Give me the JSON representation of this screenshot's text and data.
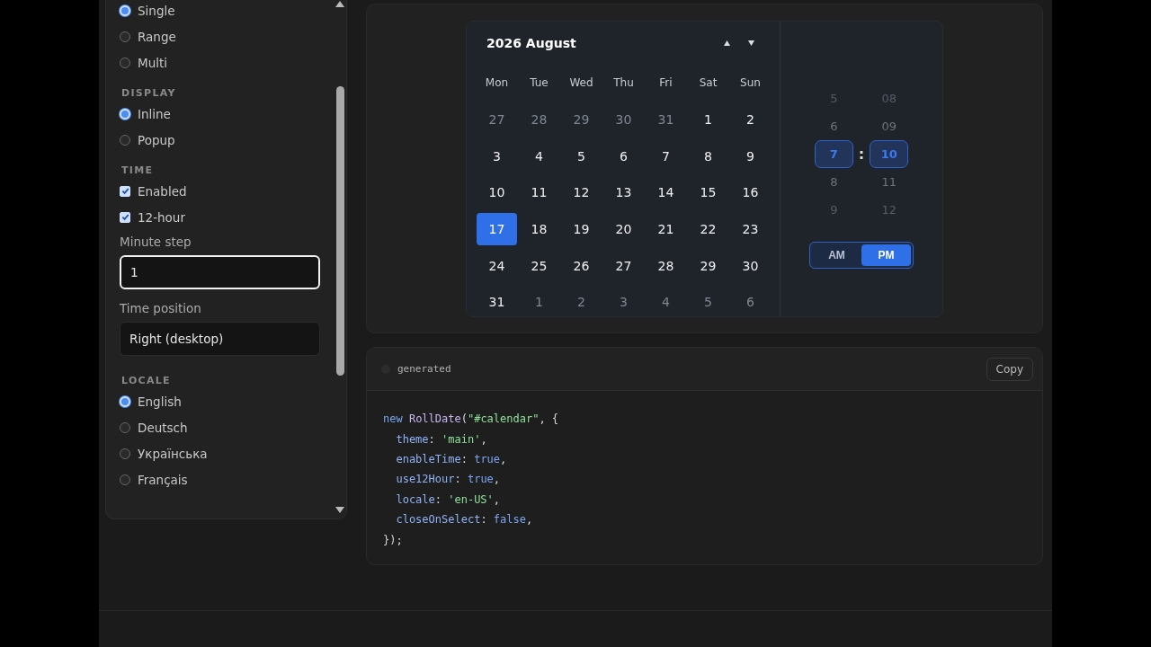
{
  "sidebar": {
    "items": [
      {
        "kind": "radio",
        "label": "Single",
        "selected": true
      },
      {
        "kind": "radio",
        "label": "Range",
        "selected": false
      },
      {
        "kind": "radio",
        "label": "Multi",
        "selected": false
      },
      {
        "kind": "heading",
        "label": "DISPLAY"
      },
      {
        "kind": "radio",
        "label": "Inline",
        "selected": true
      },
      {
        "kind": "radio",
        "label": "Popup",
        "selected": false
      },
      {
        "kind": "heading",
        "label": "TIME"
      },
      {
        "kind": "checkbox",
        "label": "Enabled",
        "checked": true
      },
      {
        "kind": "checkbox",
        "label": "12-hour",
        "checked": true
      },
      {
        "kind": "label",
        "label": "Minute step"
      },
      {
        "kind": "input",
        "value": "1",
        "focused": true
      },
      {
        "kind": "label",
        "label": "Time position"
      },
      {
        "kind": "select",
        "value": "Right (desktop)"
      },
      {
        "kind": "heading",
        "label": "LOCALE"
      },
      {
        "kind": "radio",
        "label": "English",
        "selected": true
      },
      {
        "kind": "radio",
        "label": "Deutsch",
        "selected": false
      },
      {
        "kind": "radio",
        "label": "Українська",
        "selected": false
      },
      {
        "kind": "radio",
        "label": "Français",
        "selected": false
      }
    ]
  },
  "calendar": {
    "title": "2026 August",
    "weekdays": [
      "Mon",
      "Tue",
      "Wed",
      "Thu",
      "Fri",
      "Sat",
      "Sun"
    ],
    "days": [
      {
        "label": "27",
        "muted": true,
        "selected": false
      },
      {
        "label": "28",
        "muted": true,
        "selected": false
      },
      {
        "label": "29",
        "muted": true,
        "selected": false
      },
      {
        "label": "30",
        "muted": true,
        "selected": false
      },
      {
        "label": "31",
        "muted": true,
        "selected": false
      },
      {
        "label": "1",
        "muted": false,
        "selected": false
      },
      {
        "label": "2",
        "muted": false,
        "selected": false
      },
      {
        "label": "3",
        "muted": false,
        "selected": false
      },
      {
        "label": "4",
        "muted": false,
        "selected": false
      },
      {
        "label": "5",
        "muted": false,
        "selected": false
      },
      {
        "label": "6",
        "muted": false,
        "selected": false
      },
      {
        "label": "7",
        "muted": false,
        "selected": false
      },
      {
        "label": "8",
        "muted": false,
        "selected": false
      },
      {
        "label": "9",
        "muted": false,
        "selected": false
      },
      {
        "label": "10",
        "muted": false,
        "selected": false
      },
      {
        "label": "11",
        "muted": false,
        "selected": false
      },
      {
        "label": "12",
        "muted": false,
        "selected": false
      },
      {
        "label": "13",
        "muted": false,
        "selected": false
      },
      {
        "label": "14",
        "muted": false,
        "selected": false
      },
      {
        "label": "15",
        "muted": false,
        "selected": false
      },
      {
        "label": "16",
        "muted": false,
        "selected": false
      },
      {
        "label": "17",
        "muted": false,
        "selected": true
      },
      {
        "label": "18",
        "muted": false,
        "selected": false
      },
      {
        "label": "19",
        "muted": false,
        "selected": false
      },
      {
        "label": "20",
        "muted": false,
        "selected": false
      },
      {
        "label": "21",
        "muted": false,
        "selected": false
      },
      {
        "label": "22",
        "muted": false,
        "selected": false
      },
      {
        "label": "23",
        "muted": false,
        "selected": false
      },
      {
        "label": "24",
        "muted": false,
        "selected": false
      },
      {
        "label": "25",
        "muted": false,
        "selected": false
      },
      {
        "label": "26",
        "muted": false,
        "selected": false
      },
      {
        "label": "27",
        "muted": false,
        "selected": false
      },
      {
        "label": "28",
        "muted": false,
        "selected": false
      },
      {
        "label": "29",
        "muted": false,
        "selected": false
      },
      {
        "label": "30",
        "muted": false,
        "selected": false
      },
      {
        "label": "31",
        "muted": false,
        "selected": false
      },
      {
        "label": "1",
        "muted": true,
        "selected": false
      },
      {
        "label": "2",
        "muted": true,
        "selected": false
      },
      {
        "label": "3",
        "muted": true,
        "selected": false
      },
      {
        "label": "4",
        "muted": true,
        "selected": false
      },
      {
        "label": "5",
        "muted": true,
        "selected": false
      },
      {
        "label": "6",
        "muted": true,
        "selected": false
      }
    ]
  },
  "time": {
    "hours": [
      {
        "label": "5",
        "selected": false
      },
      {
        "label": "6",
        "selected": false
      },
      {
        "label": "7",
        "selected": true
      },
      {
        "label": "8",
        "selected": false
      },
      {
        "label": "9",
        "selected": false
      }
    ],
    "separator": ":",
    "minutes": [
      {
        "label": "08",
        "selected": false
      },
      {
        "label": "09",
        "selected": false
      },
      {
        "label": "10",
        "selected": true
      },
      {
        "label": "11",
        "selected": false
      },
      {
        "label": "12",
        "selected": false
      }
    ],
    "meridiem": [
      {
        "label": "AM",
        "selected": false
      },
      {
        "label": "PM",
        "selected": true
      }
    ]
  },
  "code": {
    "label": "generated",
    "copy_button": "Copy",
    "lines": [
      [
        {
          "kind": "keyword",
          "text": "new "
        },
        {
          "kind": "name",
          "text": "RollDate"
        },
        {
          "kind": "plain",
          "text": "("
        },
        {
          "kind": "string",
          "text": "\"#calendar\""
        },
        {
          "kind": "plain",
          "text": ", {"
        }
      ],
      [
        {
          "kind": "prop",
          "text": "  theme"
        },
        {
          "kind": "plain",
          "text": ": "
        },
        {
          "kind": "string",
          "text": "'main'"
        },
        {
          "kind": "plain",
          "text": ","
        }
      ],
      [
        {
          "kind": "prop",
          "text": "  enableTime"
        },
        {
          "kind": "plain",
          "text": ": "
        },
        {
          "kind": "keyword",
          "text": "true"
        },
        {
          "kind": "plain",
          "text": ","
        }
      ],
      [
        {
          "kind": "prop",
          "text": "  use12Hour"
        },
        {
          "kind": "plain",
          "text": ": "
        },
        {
          "kind": "keyword",
          "text": "true"
        },
        {
          "kind": "plain",
          "text": ","
        }
      ],
      [
        {
          "kind": "prop",
          "text": "  locale"
        },
        {
          "kind": "plain",
          "text": ": "
        },
        {
          "kind": "string",
          "text": "'en-US'"
        },
        {
          "kind": "plain",
          "text": ","
        }
      ],
      [
        {
          "kind": "prop",
          "text": "  closeOnSelect"
        },
        {
          "kind": "plain",
          "text": ": "
        },
        {
          "kind": "keyword",
          "text": "false"
        },
        {
          "kind": "plain",
          "text": ","
        }
      ],
      [
        {
          "kind": "plain",
          "text": "});"
        }
      ]
    ]
  }
}
